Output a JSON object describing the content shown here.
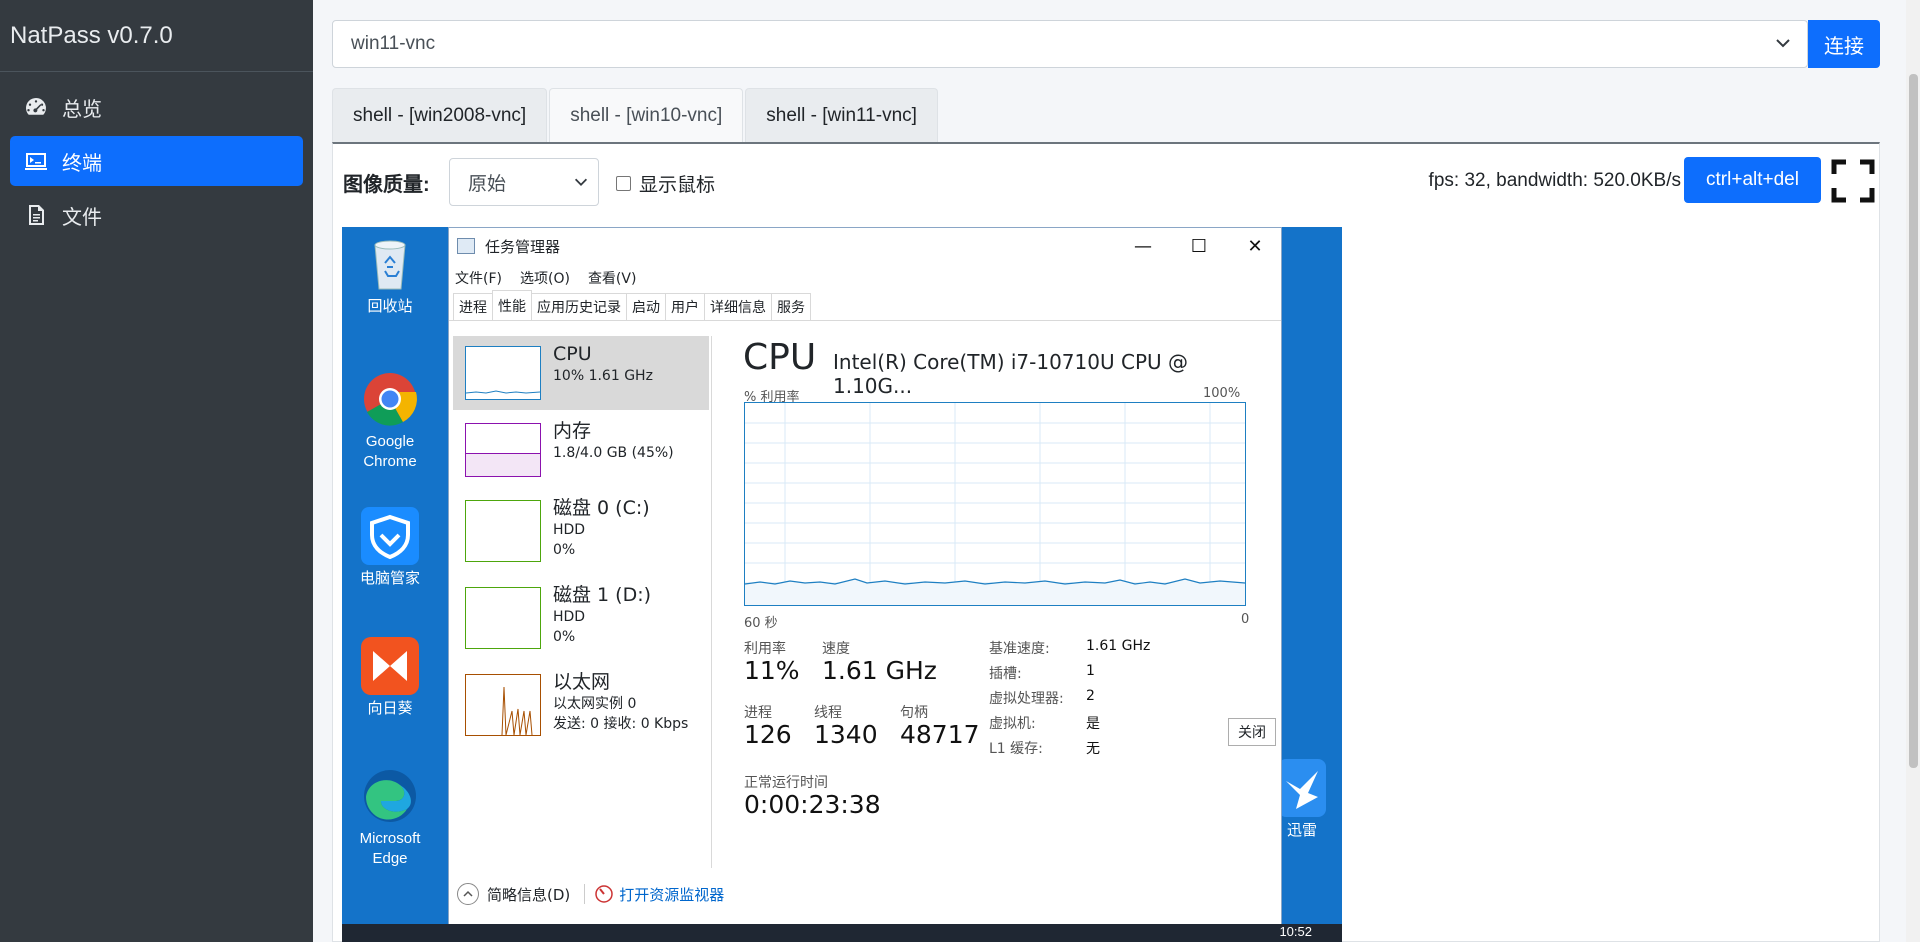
{
  "app": {
    "brand": "NatPass v0.7.0"
  },
  "sidebar": {
    "items": [
      {
        "label": "总览",
        "icon": "dashboard-icon",
        "active": false
      },
      {
        "label": "终端",
        "icon": "terminal-icon",
        "active": true
      },
      {
        "label": "文件",
        "icon": "file-icon",
        "active": false
      }
    ]
  },
  "toolbar": {
    "host_value": "win11-vnc",
    "connect_label": "连接"
  },
  "tabs": [
    {
      "label": "shell - [win2008-vnc]",
      "active": false
    },
    {
      "label": "shell - [win10-vnc]",
      "active": true
    },
    {
      "label": "shell - [win11-vnc]",
      "active": false
    }
  ],
  "vnc": {
    "quality_label": "图像质量:",
    "quality_value": "原始",
    "show_mouse_label": "显示鼠标",
    "show_mouse_checked": false,
    "stats": "fps: 32, bandwidth: 520.0KB/s",
    "cad_label": "ctrl+alt+del"
  },
  "desktop": {
    "icons": [
      {
        "label": "回收站",
        "icon": "recycle-bin-icon"
      },
      {
        "label": "Google Chrome",
        "icon": "chrome-icon"
      },
      {
        "label": "电脑管家",
        "icon": "pc-manager-icon"
      },
      {
        "label": "向日葵",
        "icon": "sunflower-icon"
      },
      {
        "label": "Microsoft Edge",
        "icon": "edge-icon"
      },
      {
        "label": "迅雷",
        "icon": "xunlei-icon"
      }
    ],
    "clock": "10:52"
  },
  "taskmgr": {
    "title": "任务管理器",
    "menu": [
      "文件(F)",
      "选项(O)",
      "查看(V)"
    ],
    "tabs": [
      "进程",
      "性能",
      "应用历史记录",
      "启动",
      "用户",
      "详细信息",
      "服务"
    ],
    "active_tab": "性能",
    "resources": [
      {
        "name": "CPU",
        "line1": "10% 1.61 GHz",
        "line2": "",
        "color": "#1e7fc2"
      },
      {
        "name": "内存",
        "line1": "1.8/4.0 GB (45%)",
        "line2": "",
        "color": "#8b12ae"
      },
      {
        "name": "磁盘 0 (C:)",
        "line1": "HDD",
        "line2": "0%",
        "color": "#4da60c"
      },
      {
        "name": "磁盘 1 (D:)",
        "line1": "HDD",
        "line2": "0%",
        "color": "#4da60c"
      },
      {
        "name": "以太网",
        "line1": "以太网实例 0",
        "line2": "发送: 0 接收: 0 Kbps",
        "color": "#a74f01"
      }
    ],
    "cpu": {
      "title": "CPU",
      "model": "Intel(R) Core(TM) i7-10710U CPU @ 1.10G...",
      "util_label": "% 利用率",
      "max_label": "100%",
      "time_label": "60 秒",
      "zero_label": "0",
      "stats": [
        {
          "label": "利用率",
          "value": "11%"
        },
        {
          "label": "速度",
          "value": "1.61 GHz"
        },
        {
          "label": "进程",
          "value": "126"
        },
        {
          "label": "线程",
          "value": "1340"
        },
        {
          "label": "句柄",
          "value": "48717"
        }
      ],
      "uptime_label": "正常运行时间",
      "uptime": "0:00:23:38",
      "details": [
        {
          "k": "基准速度:",
          "v": "1.61 GHz"
        },
        {
          "k": "插槽:",
          "v": "1"
        },
        {
          "k": "虚拟处理器:",
          "v": "2"
        },
        {
          "k": "虚拟机:",
          "v": "是"
        },
        {
          "k": "L1 缓存:",
          "v": "无"
        }
      ]
    },
    "close_label": "关闭",
    "footer": {
      "brief": "简略信息(D)",
      "monitor": "打开资源监视器"
    }
  }
}
